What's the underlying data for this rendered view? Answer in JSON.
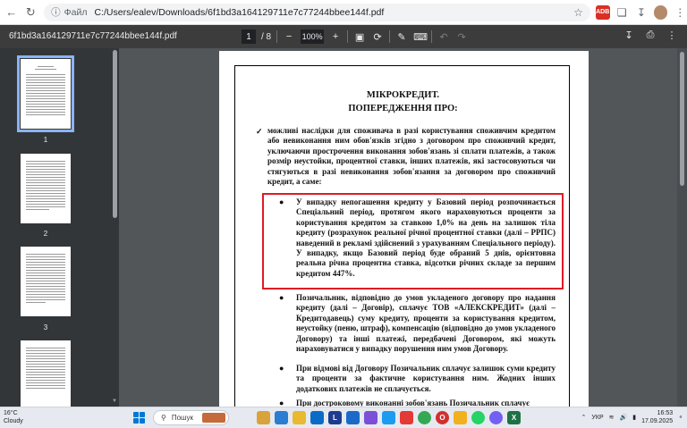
{
  "browser": {
    "site_chip": "Файл",
    "url": "C:/Users/ealev/Downloads/6f1bd3a164129711e7c77244bbee144f.pdf"
  },
  "pdf_toolbar": {
    "file_name": "6f1bd3a164129711e7c77244bbee144f.pdf",
    "current_page": "1",
    "total_pages": "/ 8",
    "zoom": "100%"
  },
  "thumbnails": [
    {
      "number": "1",
      "active": true
    },
    {
      "number": "2",
      "active": false
    },
    {
      "number": "3",
      "active": false
    }
  ],
  "document": {
    "title_line1": "МІКРОКРЕДИТ.",
    "title_line2": "ПОПЕРЕДЖЕННЯ ПРО:",
    "intro": "можливі наслідки для споживача в разі користування споживчим кредитом або невиконання ним обов'язків згідно з договором про споживчий кредит, уключаючи прострочення виконання зобов'язань зі сплати платежів, а також розмір неустойки, процентної ставки, інших платежів, які застосовуються чи стягуються в разі невиконання зобов'язання за договором про споживчий кредит, а саме:",
    "bullets": [
      "У випадку непогашення кредиту у Базовий період розпочинається Спеціальний період, протягом якого нараховуються проценти за користування кредитом за ставкою 1,0% на день на залишок тіла кредиту (розрахунок реальної річної процентної ставки (далі – РРПС) наведений в рекламі здійснений з урахуванням Спеціального періоду). У випадку, якщо Базовий період буде обраний 5 днів, орієнтовна реальна річна процентна ставка, відсотки річних складе за першим кредитом 447%.",
      "Позичальник, відповідно до умов укладеного договору про надання кредиту (далі – Договір), сплачує ТОВ «АЛЕКСКРЕДИТ» (далі – Кредитодавець) суму кредиту, проценти за користування кредитом, неустойку (пеню, штраф), компенсацію (відповідно до умов укладеного Договору) та інші платежі, передбачені Договором, які можуть нараховуватися у випадку порушення ним умов Договору.",
      "При відмові від Договору Позичальник сплачує залишок суми кредиту та проценти за фактичне користування ним. Жодних інших додаткових платежів не сплачується.",
      "При достроковому виконанні зобов'язань Позичальник сплачує"
    ]
  },
  "taskbar": {
    "temperature": "16°C",
    "weather": "Cloudy",
    "search_label": "Пошук",
    "language": "УКР",
    "time": "16:53",
    "date": "17.09.2025"
  }
}
